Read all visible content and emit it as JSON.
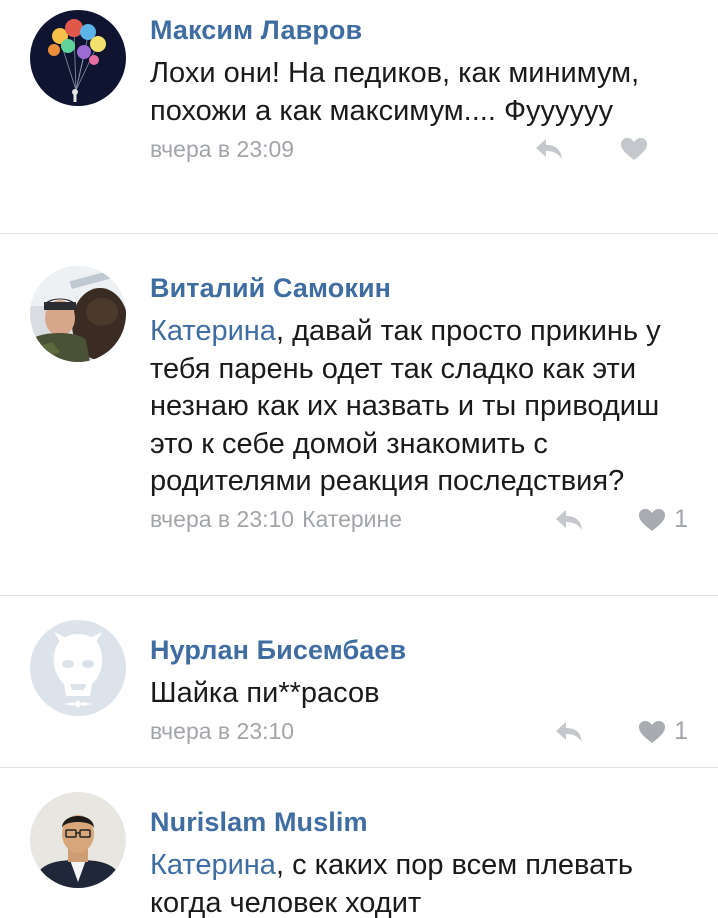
{
  "comments": [
    {
      "author": "Максим Лавров",
      "text": "Лохи они! На педиков, как минимум, похожи а как максимум.... Фуууууу",
      "mention": "",
      "time": "вчера в 23:09",
      "reply_to": "",
      "likes": ""
    },
    {
      "author": "Виталий Самокин",
      "mention": "Катерина",
      "text": ", давай так просто прикинь у тебя парень одет так сладко как эти незнаю как их назвать  и ты приводиш это к себе домой знакомить с родителями реакция последствия?",
      "time": "вчера в 23:10",
      "reply_to": "Катерине",
      "likes": "1"
    },
    {
      "author": "Нурлан Бисембаев",
      "mention": "",
      "text": "Шайка пи**расов",
      "time": "вчера в 23:10",
      "reply_to": "",
      "likes": "1"
    },
    {
      "author": "Nurislam Muslim",
      "mention": "Катерина",
      "text": ", с каких пор всем плевать когда человек ходит",
      "time": "",
      "reply_to": "",
      "likes": ""
    }
  ],
  "icons": {
    "reply": "reply-arrow-icon",
    "like": "heart-icon"
  },
  "colors": {
    "author": "#3f6da1",
    "meta": "#a1a5aa",
    "divider": "#dfe1e4"
  }
}
